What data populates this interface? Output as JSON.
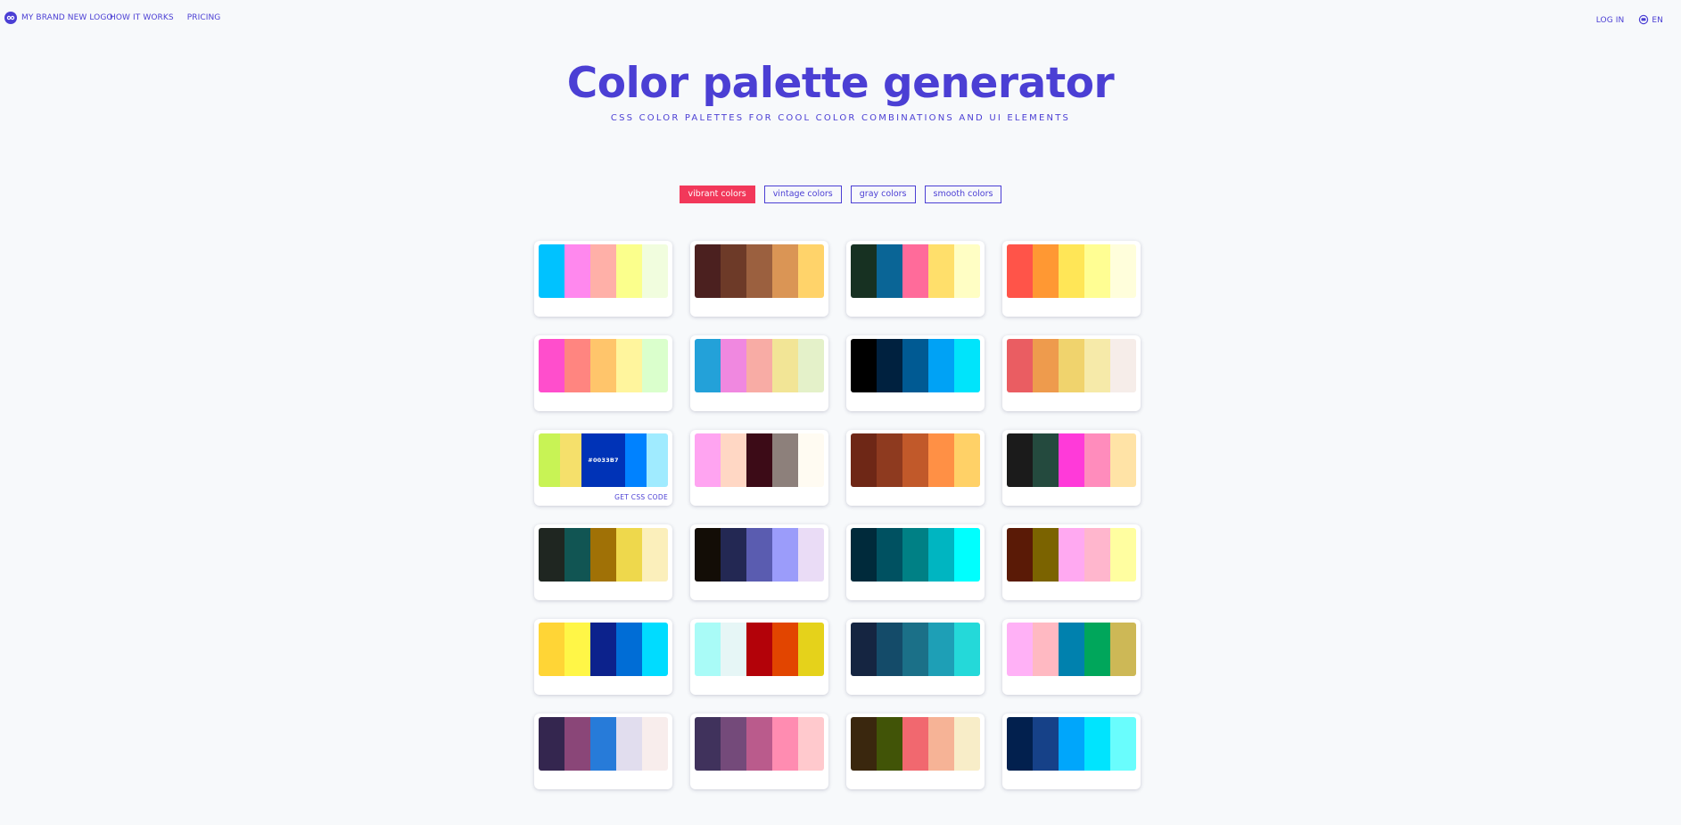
{
  "nav": {
    "brand": "MY BRAND NEW LOGO",
    "links": [
      "HOW IT WORKS",
      "PRICING"
    ],
    "login": "LOG IN",
    "language": "EN",
    "logo_icon": "owl-logo-icon",
    "language_icon": "globe-chat-icon"
  },
  "hero": {
    "title": "Color palette generator",
    "subtitle": "CSS COLOR PALETTES FOR COOL COLOR COMBINATIONS AND UI ELEMENTS"
  },
  "filters": {
    "active_index": 0,
    "items": [
      "vibrant colors",
      "vintage colors",
      "gray colors",
      "smooth colors"
    ]
  },
  "accent_colors": {
    "primary": "#4b3fd4",
    "active_filter": "#f2385a"
  },
  "palettes": [
    {
      "colors": [
        "#00c2ff",
        "#ff88ee",
        "#ffb0a8",
        "#fbff8c",
        "#f1fdde"
      ]
    },
    {
      "colors": [
        "#4b201f",
        "#6d3a28",
        "#9b603f",
        "#da9555",
        "#ffd36a"
      ]
    },
    {
      "colors": [
        "#173122",
        "#0a6596",
        "#ff6b9a",
        "#ffdf6b",
        "#fffec4"
      ]
    },
    {
      "colors": [
        "#ff5449",
        "#ff9833",
        "#ffe657",
        "#fffe93",
        "#fffedb"
      ]
    },
    {
      "colors": [
        "#ff4ecc",
        "#ff8580",
        "#ffc56b",
        "#fff59d",
        "#daffcc"
      ]
    },
    {
      "colors": [
        "#23a1d9",
        "#f088e0",
        "#f8aca5",
        "#f2e596",
        "#e4f1c9"
      ]
    },
    {
      "colors": [
        "#000000",
        "#00213f",
        "#005a93",
        "#00a2f5",
        "#00e4fb"
      ]
    },
    {
      "colors": [
        "#ea5d62",
        "#ee9b4d",
        "#f0d36d",
        "#f6eaa9",
        "#f6ede9"
      ]
    },
    {
      "colors": [
        "#c8f355",
        "#f5e06b",
        "#0033b7",
        "#0082ff",
        "#a0ebff"
      ],
      "hover_index": 2,
      "hover_hex": "#0033B7",
      "action": "GET CSS CODE"
    },
    {
      "colors": [
        "#ffa4f1",
        "#ffd7c4",
        "#3c0b17",
        "#8d807b",
        "#fffbf2"
      ]
    },
    {
      "colors": [
        "#6e2716",
        "#8e3a1f",
        "#c1592a",
        "#ff9045",
        "#ffd167"
      ]
    },
    {
      "colors": [
        "#1b1b1b",
        "#244a3e",
        "#ff3ad9",
        "#ff8cbc",
        "#ffe3a6"
      ]
    },
    {
      "colors": [
        "#1f2621",
        "#115553",
        "#a07106",
        "#eed84c",
        "#fbefbb"
      ]
    },
    {
      "colors": [
        "#130d06",
        "#232853",
        "#5a5cb0",
        "#9b9cfa",
        "#eadcf6"
      ]
    },
    {
      "colors": [
        "#002a3b",
        "#005161",
        "#008085",
        "#00b5c1",
        "#00fffe"
      ]
    },
    {
      "colors": [
        "#5a1a06",
        "#7b6300",
        "#ffa9f1",
        "#ffb6cd",
        "#fffea0"
      ]
    },
    {
      "colors": [
        "#ffd536",
        "#fff647",
        "#0c228c",
        "#006dd6",
        "#00dcff"
      ]
    },
    {
      "colors": [
        "#a9fbf7",
        "#e6f6f6",
        "#b30209",
        "#e24500",
        "#e5d21b"
      ]
    },
    {
      "colors": [
        "#152541",
        "#144b69",
        "#1b7088",
        "#1e9fb6",
        "#24d9d9"
      ]
    },
    {
      "colors": [
        "#ffb1f6",
        "#ffb9c2",
        "#0081ae",
        "#00a65b",
        "#cdb856"
      ]
    },
    {
      "colors": [
        "#34264f",
        "#8a4678",
        "#277bd9",
        "#e1ddee",
        "#f8edec"
      ]
    },
    {
      "colors": [
        "#40325c",
        "#744a7a",
        "#ba5b8c",
        "#ff8cb1",
        "#ffc9cd"
      ]
    },
    {
      "colors": [
        "#3a270e",
        "#415407",
        "#f1686f",
        "#f6b396",
        "#f8edc8"
      ]
    },
    {
      "colors": [
        "#02204e",
        "#164188",
        "#00a6fb",
        "#00e4fe",
        "#69fdfd"
      ]
    }
  ]
}
